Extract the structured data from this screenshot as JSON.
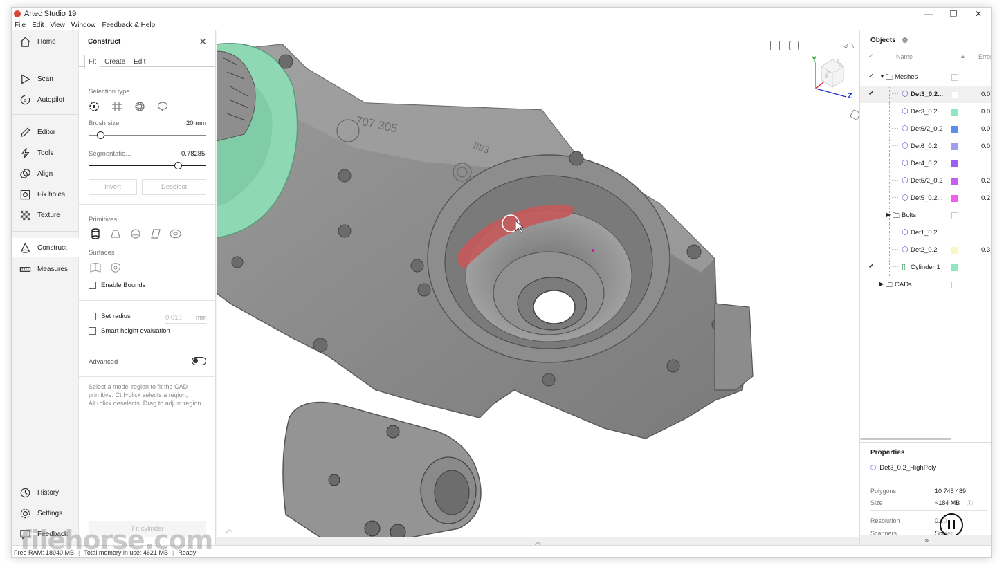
{
  "titlebar": {
    "title": "Artec Studio 19",
    "minimize": "—",
    "restore": "❐",
    "close": "✕"
  },
  "menu": [
    "File",
    "Edit",
    "View",
    "Window",
    "Feedback & Help"
  ],
  "nav": {
    "home": "Home",
    "scan": "Scan",
    "autopilot": "Autopilot",
    "editor": "Editor",
    "tools": "Tools",
    "align": "Align",
    "fix_holes": "Fix holes",
    "texture": "Texture",
    "construct": "Construct",
    "measures": "Measures",
    "history": "History",
    "settings": "Settings",
    "feedback": "Feedback"
  },
  "construct": {
    "title": "Construct",
    "tabs": [
      "Fit",
      "Create",
      "Edit"
    ],
    "selection_type": "Selection type",
    "brush_size_label": "Brush size",
    "brush_size_value": "20 mm",
    "segmentation_label": "Segmentatio...",
    "segmentation_value": "0.78285",
    "invert": "Invert",
    "deselect": "Deselect",
    "primitives": "Primitives",
    "surfaces": "Surfaces",
    "enable_bounds": "Enable Bounds",
    "set_radius": "Set radius",
    "radius_value": "0.010",
    "radius_unit": "mm",
    "smart_height": "Smart height evaluation",
    "advanced": "Advanced",
    "hint": "Select a model region to fit the CAD primitive. Ctrl+click selects a region, Alt+click deselects. Drag to adjust region.",
    "fit_button": "Fit cylinder"
  },
  "viewport": {
    "axis_y": "Y",
    "axis_z": "Z",
    "cube_back": "BACK",
    "cube_left": "LEFT",
    "bottom_arrow": "︽",
    "scan_text_1": "707 305",
    "scan_text_2": "III/3"
  },
  "objects": {
    "title": "Objects",
    "columns": {
      "name": "Name",
      "error": "Error"
    },
    "rows": [
      {
        "name": "Meshes",
        "color": "",
        "error": "",
        "check": "✓",
        "type": "folder"
      },
      {
        "name": "Det3_0.2...",
        "color": "#ffffff",
        "error": "0.0",
        "check": "✔",
        "type": "mesh"
      },
      {
        "name": "Det3_0.2...",
        "color": "#8de8c0",
        "error": "0.0",
        "check": "",
        "type": "mesh"
      },
      {
        "name": "Det6/2_0.2",
        "color": "#5b8ef0",
        "error": "0.0",
        "check": "",
        "type": "mesh"
      },
      {
        "name": "Det6_0.2",
        "color": "#9f9ef0",
        "error": "0.0",
        "check": "",
        "type": "mesh"
      },
      {
        "name": "Det4_0.2",
        "color": "#9a5ef0",
        "error": "",
        "check": "",
        "type": "mesh"
      },
      {
        "name": "Det5/2_0.2",
        "color": "#c45ef0",
        "error": "0.2",
        "check": "",
        "type": "mesh"
      },
      {
        "name": "Det5_0.2...",
        "color": "#ef5ee8",
        "error": "0.2",
        "check": "",
        "type": "mesh"
      },
      {
        "name": "Bolts",
        "color": "",
        "error": "",
        "check": "",
        "type": "folder"
      },
      {
        "name": "Det1_0.2",
        "color": "",
        "error": "",
        "check": "",
        "type": "mesh"
      },
      {
        "name": "Det2_0.2",
        "color": "#fbf7c4",
        "error": "0.3",
        "check": "",
        "type": "mesh"
      },
      {
        "name": "Cylinder 1",
        "color": "#8de8c0",
        "error": "",
        "check": "✔",
        "type": "cad"
      },
      {
        "name": "CADs",
        "color": "",
        "error": "",
        "check": "",
        "type": "folder"
      }
    ]
  },
  "properties": {
    "title": "Properties",
    "object": "Det3_0.2_HighPoly",
    "polygons_label": "Polygons",
    "polygons": "10 745 489",
    "size_label": "Size",
    "size": "~184 MB",
    "resolution_label": "Resolution",
    "resolution": "0.20",
    "scanners_label": "Scanners",
    "scanners": "Spider",
    "expand": "»"
  },
  "status": {
    "free_ram": "Free RAM: 18940 MB",
    "total_memory": "Total memory in use: 4621 MB",
    "state": "Ready"
  },
  "watermark": "filehorse.com",
  "colors": {
    "accent_red": "#c0463a",
    "cad_green": "#8de8c0",
    "axis_blue": "#1a2fd0",
    "axis_green": "#2aa830"
  }
}
